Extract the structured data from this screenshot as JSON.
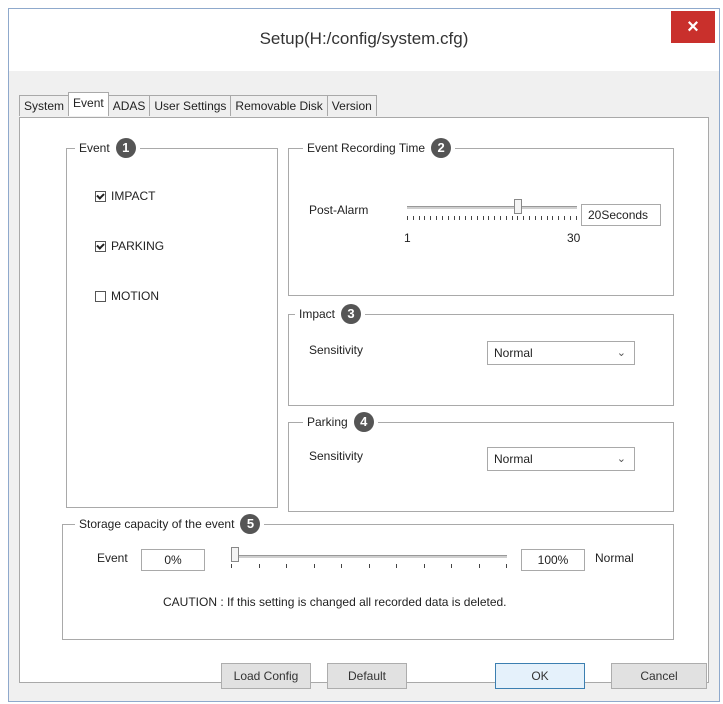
{
  "window": {
    "title": "Setup(H:/config/system.cfg)",
    "close_symbol": "×"
  },
  "tabs": [
    "System",
    "Event",
    "ADAS",
    "User Settings",
    "Removable Disk",
    "Version"
  ],
  "event_group": {
    "legend": "Event",
    "badge": "1",
    "items": [
      {
        "label": "IMPACT",
        "checked": true
      },
      {
        "label": "PARKING",
        "checked": true
      },
      {
        "label": "MOTION",
        "checked": false
      }
    ]
  },
  "recording_group": {
    "legend": "Event Recording Time",
    "badge": "2",
    "post_alarm_label": "Post-Alarm",
    "slider_min": "1",
    "slider_max": "30",
    "slider_value": 20,
    "value_text": "20Seconds"
  },
  "impact_group": {
    "legend": "Impact",
    "badge": "3",
    "sensitivity_label": "Sensitivity",
    "sensitivity_value": "Normal"
  },
  "parking_group": {
    "legend": "Parking",
    "badge": "4",
    "sensitivity_label": "Sensitivity",
    "sensitivity_value": "Normal"
  },
  "storage_group": {
    "legend": "Storage capacity of the event",
    "badge": "5",
    "event_label": "Event",
    "event_value": "0%",
    "normal_value": "100%",
    "normal_label": "Normal",
    "slider_fraction": 0,
    "caution": "CAUTION : If this setting is changed all recorded data is deleted."
  },
  "buttons": {
    "load_config": "Load Config",
    "default": "Default",
    "ok": "OK",
    "cancel": "Cancel"
  },
  "icons": {
    "chevron": "⌄"
  }
}
